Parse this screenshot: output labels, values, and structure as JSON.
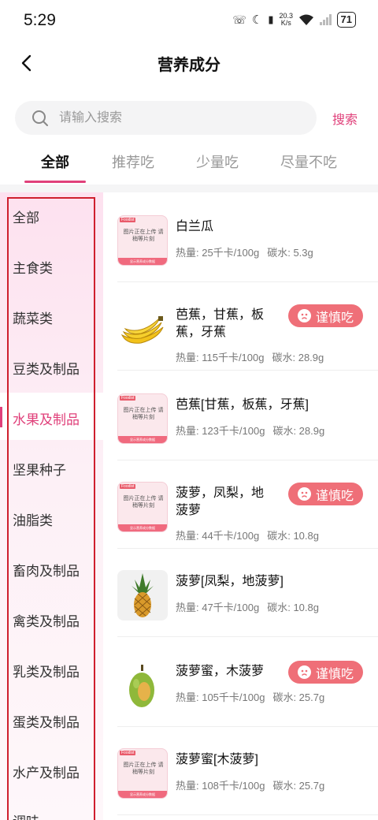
{
  "status_bar": {
    "time": "5:29",
    "net_speed_value": "20.3",
    "net_speed_unit": "K/s",
    "battery": "71"
  },
  "header": {
    "title": "营养成分",
    "back_icon": "chevron-left-icon"
  },
  "search": {
    "placeholder": "请输入搜索",
    "button_label": "搜索"
  },
  "tabs": [
    {
      "label": "全部",
      "active": true
    },
    {
      "label": "推荐吃",
      "active": false
    },
    {
      "label": "少量吃",
      "active": false
    },
    {
      "label": "尽量不吃",
      "active": false
    }
  ],
  "categories": [
    "全部",
    "主食类",
    "蔬菜类",
    "豆类及制品",
    "水果及制品",
    "坚果种子",
    "油脂类",
    "畜肉及制品",
    "禽类及制品",
    "乳类及制品",
    "蛋类及制品",
    "水产及制品",
    "调味"
  ],
  "active_category": "水果及制品",
  "placeholder_image": {
    "tag": "Foodist",
    "text": "图片正在上传 请稍等片刻",
    "footer": "显示营养成分数据"
  },
  "food_items": [
    {
      "name": "白兰瓜",
      "calories": "热量: 25千卡/100g",
      "carbs": "碳水: 5.3g",
      "caution": "",
      "image": "placeholder"
    },
    {
      "name": "芭蕉，甘蕉，板蕉，牙蕉",
      "calories": "热量: 115千卡/100g",
      "carbs": "碳水: 28.9g",
      "caution": "谨慎吃",
      "image": "banana"
    },
    {
      "name": "芭蕉[甘蕉，板蕉，牙蕉]",
      "calories": "热量: 123千卡/100g",
      "carbs": "碳水: 28.9g",
      "caution": "",
      "image": "placeholder"
    },
    {
      "name": "菠萝，凤梨，地菠萝",
      "calories": "热量: 44千卡/100g",
      "carbs": "碳水: 10.8g",
      "caution": "谨慎吃",
      "image": "placeholder"
    },
    {
      "name": "菠萝[凤梨，地菠萝]",
      "calories": "热量: 47千卡/100g",
      "carbs": "碳水: 10.8g",
      "caution": "",
      "image": "pineapple"
    },
    {
      "name": "菠萝蜜，木菠萝",
      "calories": "热量: 105千卡/100g",
      "carbs": "碳水: 25.7g",
      "caution": "谨慎吃",
      "image": "jackfruit"
    },
    {
      "name": "菠萝蜜[木菠萝]",
      "calories": "热量: 108千卡/100g",
      "carbs": "碳水: 25.7g",
      "caution": "",
      "image": "placeholder"
    }
  ],
  "colors": {
    "accent": "#e0407a",
    "caution_bg": "#ef6f78",
    "highlight_frame": "#cf1f2e"
  }
}
